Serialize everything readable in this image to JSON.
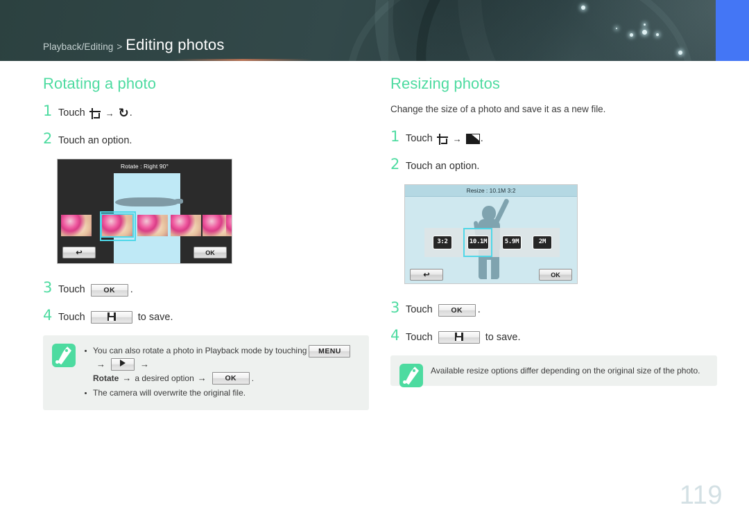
{
  "header": {
    "breadcrumb_parent": "Playback/Editing",
    "breadcrumb_separator": ">",
    "breadcrumb_title": "Editing photos",
    "accent_tab_color": "#4476f5",
    "background_color": "#2f4544"
  },
  "theme": {
    "accent_green": "#4ddba0",
    "note_background": "#eef1ef",
    "selection_cyan": "#4fd7e8",
    "page_number_color": "#d3e0e4"
  },
  "left_column": {
    "title": "Rotating a photo",
    "steps": [
      {
        "num": "1",
        "prefix": "Touch",
        "icon_a": "crop-icon",
        "arrow": "→",
        "icon_b": "rotate-icon",
        "suffix": "."
      },
      {
        "num": "2",
        "text": "Touch an option."
      },
      {
        "num": "3",
        "prefix": "Touch",
        "button": "OK",
        "suffix": "."
      },
      {
        "num": "4",
        "prefix": "Touch",
        "button_icon": "save-icon",
        "suffix": "to save."
      }
    ],
    "camera_screen": {
      "name": "rotate-screen",
      "title": "Rotate : Right 90°",
      "back_button": "↩",
      "ok_button": "OK",
      "thumbnail_count": 6,
      "selected_thumbnail_index": 1
    },
    "note": {
      "icon": "quill-note-icon",
      "bullets": [
        {
          "parts": [
            {
              "type": "text",
              "value": "You can also rotate a photo in Playback mode by touching"
            },
            {
              "type": "button",
              "value": "MENU"
            },
            {
              "type": "arrow",
              "value": "→"
            },
            {
              "type": "icon-button",
              "value": "play-icon"
            },
            {
              "type": "arrow",
              "value": "→"
            },
            {
              "type": "bold",
              "value": "Rotate"
            },
            {
              "type": "arrow",
              "value": "→"
            },
            {
              "type": "text",
              "value": "a desired option"
            },
            {
              "type": "arrow",
              "value": "→"
            },
            {
              "type": "button",
              "value": "OK"
            },
            {
              "type": "text",
              "value": "."
            }
          ]
        },
        {
          "text": "The camera will overwrite the original file."
        }
      ]
    }
  },
  "right_column": {
    "title": "Resizing photos",
    "intro": "Change the size of a photo and save it as a new file.",
    "steps": [
      {
        "num": "1",
        "prefix": "Touch",
        "icon_a": "crop-icon",
        "arrow": "→",
        "icon_b": "resize-icon",
        "suffix": "."
      },
      {
        "num": "2",
        "text": "Touch an option."
      },
      {
        "num": "3",
        "prefix": "Touch",
        "button": "OK",
        "suffix": "."
      },
      {
        "num": "4",
        "prefix": "Touch",
        "button_icon": "save-icon",
        "suffix": "to save."
      }
    ],
    "camera_screen": {
      "name": "resize-screen",
      "title": "Resize : 10.1M 3:2",
      "back_button": "↩",
      "ok_button": "OK",
      "options": [
        "3:2",
        "10.1M",
        "5.9M",
        "2M"
      ],
      "selected_option": "10.1M",
      "selected_option_index": 1
    },
    "note": {
      "icon": "quill-note-icon",
      "text": "Available resize options differ depending on the original size of the photo."
    }
  },
  "footer": {
    "page_number": "119"
  }
}
